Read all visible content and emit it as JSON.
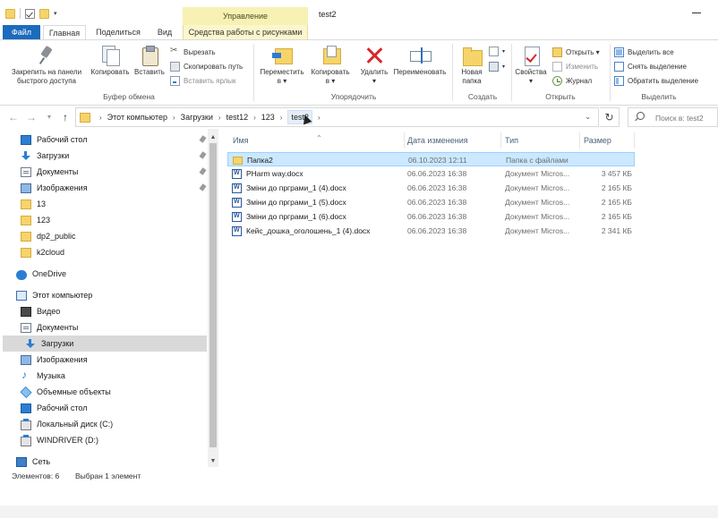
{
  "titlebar": {
    "title": "test2",
    "contextual_tab_header": "Управление"
  },
  "tabs": {
    "file": "Файл",
    "home": "Главная",
    "share": "Поделиться",
    "view": "Вид",
    "picture_tools": "Средства работы с рисунками"
  },
  "ribbon": {
    "clipboard": {
      "pin_quick_access": [
        "Закрепить на панели",
        "быстрого доступа"
      ],
      "copy": "Копировать",
      "paste": "Вставить",
      "cut": "Вырезать",
      "copy_path": "Скопировать путь",
      "paste_shortcut": "Вставить ярлык",
      "group_label": "Буфер обмена"
    },
    "organize": {
      "move_to": [
        "Переместить",
        "в ▾"
      ],
      "copy_to": [
        "Копировать",
        "в ▾"
      ],
      "delete": [
        "Удалить",
        "▾"
      ],
      "rename": "Переименовать",
      "group_label": "Упорядочить"
    },
    "new": {
      "new_folder": [
        "Новая",
        "папка"
      ],
      "group_label": "Создать"
    },
    "open": {
      "properties": [
        "Свойства",
        "▾"
      ],
      "open": "Открыть ▾",
      "edit": "Изменить",
      "history": "Журнал",
      "group_label": "Открыть"
    },
    "select": {
      "select_all": "Выделить все",
      "select_none": "Снять выделение",
      "invert_selection": "Обратить выделение",
      "group_label": "Выделить"
    }
  },
  "address": {
    "crumbs": [
      "Этот компьютер",
      "Загрузки",
      "test12",
      "123",
      "test2"
    ],
    "search_placeholder": "Поиск в: test2"
  },
  "navigation": {
    "quick_access": [
      {
        "label": "Рабочий стол",
        "icon": "desktop-icon",
        "pinned": true
      },
      {
        "label": "Загрузки",
        "icon": "downloads-icon",
        "pinned": true
      },
      {
        "label": "Документы",
        "icon": "documents-icon",
        "pinned": true
      },
      {
        "label": "Изображения",
        "icon": "pictures-icon",
        "pinned": true
      },
      {
        "label": "13",
        "icon": "folder-icon",
        "pinned": false
      },
      {
        "label": "123",
        "icon": "folder-icon",
        "pinned": false
      },
      {
        "label": "dp2_public",
        "icon": "folder-icon",
        "pinned": false
      },
      {
        "label": "k2cloud",
        "icon": "folder-icon",
        "pinned": false
      }
    ],
    "onedrive": "OneDrive",
    "this_pc": "Этот компьютер",
    "this_pc_items": [
      {
        "label": "Видео",
        "icon": "videos-icon"
      },
      {
        "label": "Документы",
        "icon": "documents-icon"
      },
      {
        "label": "Загрузки",
        "icon": "downloads-icon",
        "selected": true
      },
      {
        "label": "Изображения",
        "icon": "pictures-icon"
      },
      {
        "label": "Музыка",
        "icon": "music-icon"
      },
      {
        "label": "Объемные объекты",
        "icon": "3d-objects-icon"
      },
      {
        "label": "Рабочий стол",
        "icon": "desktop-icon"
      },
      {
        "label": "Локальный диск (C:)",
        "icon": "drive-icon"
      },
      {
        "label": "WINDRIVER (D:)",
        "icon": "drive-icon"
      }
    ],
    "network": "Сеть"
  },
  "filelist": {
    "columns": {
      "name": "Имя",
      "date": "Дата изменения",
      "type": "Тип",
      "size": "Размер"
    },
    "rows": [
      {
        "name": "Папка2",
        "date": "06.10.2023 12:11",
        "type": "Папка с файлами",
        "size": "",
        "icon": "folder-icon",
        "selected": true
      },
      {
        "name": "PHarm way.docx",
        "date": "06.06.2023 16:38",
        "type": "Документ Micros...",
        "size": "3 457 КБ",
        "icon": "word-doc-icon"
      },
      {
        "name": "Зміни до прграми_1 (4).docx",
        "date": "06.06.2023 16:38",
        "type": "Документ Micros...",
        "size": "2 165 КБ",
        "icon": "word-doc-icon"
      },
      {
        "name": "Зміни до прграми_1 (5).docx",
        "date": "06.06.2023 16:38",
        "type": "Документ Micros...",
        "size": "2 165 КБ",
        "icon": "word-doc-icon"
      },
      {
        "name": "Зміни до прграми_1 (6).docx",
        "date": "06.06.2023 16:38",
        "type": "Документ Micros...",
        "size": "2 165 КБ",
        "icon": "word-doc-icon"
      },
      {
        "name": "Кейс_дошка_оголошень_1 (4).docx",
        "date": "06.06.2023 16:38",
        "type": "Документ Micros...",
        "size": "2 341 КБ",
        "icon": "word-doc-icon"
      }
    ]
  },
  "status": {
    "items_count": "Элементов: 6",
    "selected_count": "Выбран 1 элемент"
  },
  "colors": {
    "file_tab": "#1c6bbd",
    "contextual_tab": "#f7f1b4",
    "selection": "#cce8ff",
    "nav_selected": "#d9d9d9",
    "delete_red": "#d8282d",
    "folder_yellow": "#f6d46a"
  }
}
